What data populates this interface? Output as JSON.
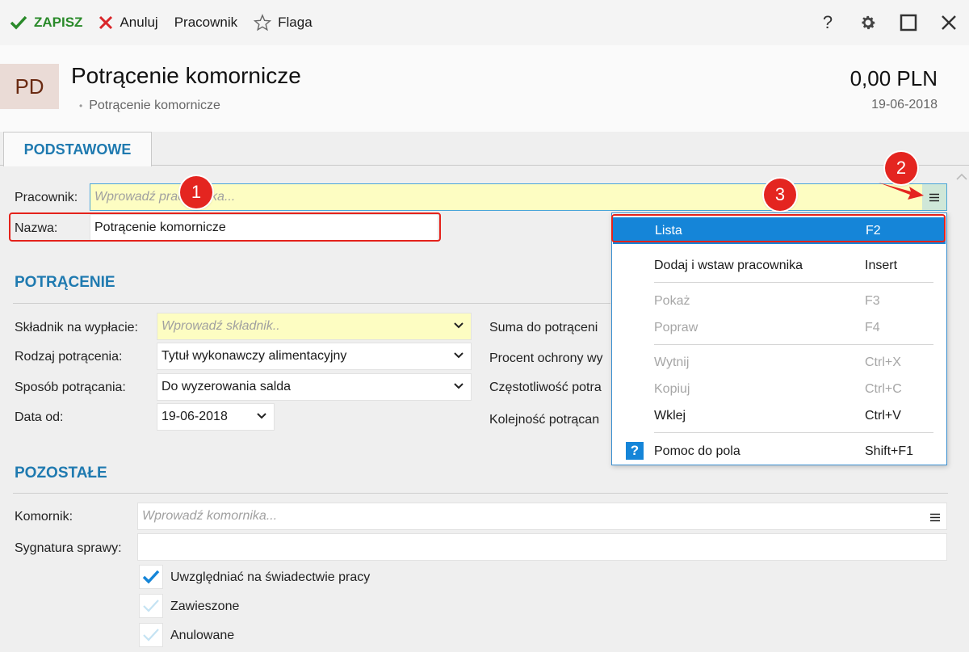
{
  "toolbar": {
    "save": "ZAPISZ",
    "cancel": "Anuluj",
    "employee": "Pracownik",
    "flag": "Flaga",
    "help": "?"
  },
  "header": {
    "badge": "PD",
    "title": "Potrącenie komornicze",
    "subtitle": "Potrącenie komornicze",
    "amount": "0,00 PLN",
    "date": "19-06-2018"
  },
  "tabs": [
    {
      "label": "PODSTAWOWE",
      "active": true
    }
  ],
  "form": {
    "pracownik": {
      "label": "Pracownik:",
      "placeholder": "Wprowadź pracownika..."
    },
    "nazwa": {
      "label": "Nazwa:",
      "value": "Potrącenie komornicze"
    }
  },
  "sections": {
    "potracenie": "POTRĄCENIE",
    "pozostale": "POZOSTAŁE"
  },
  "potracenie": {
    "skladnik": {
      "label": "Składnik na wypłacie:",
      "placeholder": "Wprowadź składnik.."
    },
    "rodzaj": {
      "label": "Rodzaj potrącenia:",
      "value": "Tytuł wykonawczy alimentacyjny"
    },
    "sposob": {
      "label": "Sposób potrącania:",
      "value": "Do wyzerowania salda"
    },
    "data_od": {
      "label": "Data od:",
      "value": "19-06-2018"
    },
    "right_labels": [
      "Suma do potrąceni",
      "Procent ochrony wy",
      "Częstotliwość potra",
      "Kolejność potrącan"
    ]
  },
  "pozostale": {
    "komornik": {
      "label": "Komornik:",
      "placeholder": "Wprowadź komornika..."
    },
    "sygnatura": {
      "label": "Sygnatura sprawy:",
      "value": ""
    },
    "checkboxes": [
      {
        "label": "Uwzględniać na świadectwie pracy",
        "checked": true
      },
      {
        "label": "Zawieszone",
        "checked": false
      },
      {
        "label": "Anulowane",
        "checked": false
      }
    ]
  },
  "context_menu": {
    "items": [
      {
        "label": "Lista",
        "shortcut": "F2",
        "state": "selected"
      },
      {
        "label": "Dodaj i wstaw pracownika",
        "shortcut": "Insert",
        "state": "enabled"
      },
      {
        "label": "Pokaż",
        "shortcut": "F3",
        "state": "disabled"
      },
      {
        "label": "Popraw",
        "shortcut": "F4",
        "state": "disabled"
      },
      {
        "label": "Wytnij",
        "shortcut": "Ctrl+X",
        "state": "disabled"
      },
      {
        "label": "Kopiuj",
        "shortcut": "Ctrl+C",
        "state": "disabled"
      },
      {
        "label": "Wklej",
        "shortcut": "Ctrl+V",
        "state": "enabled"
      },
      {
        "label": "Pomoc do pola",
        "shortcut": "Shift+F1",
        "state": "enabled"
      }
    ]
  },
  "callouts": [
    "1",
    "2",
    "3"
  ],
  "colors": {
    "accent": "#1f7ab0",
    "save_green": "#2a8a2a",
    "cancel_red": "#d9262a",
    "callout_red": "#e42520",
    "required_yellow": "#fdfdc2",
    "menu_selected": "#1585d8"
  }
}
